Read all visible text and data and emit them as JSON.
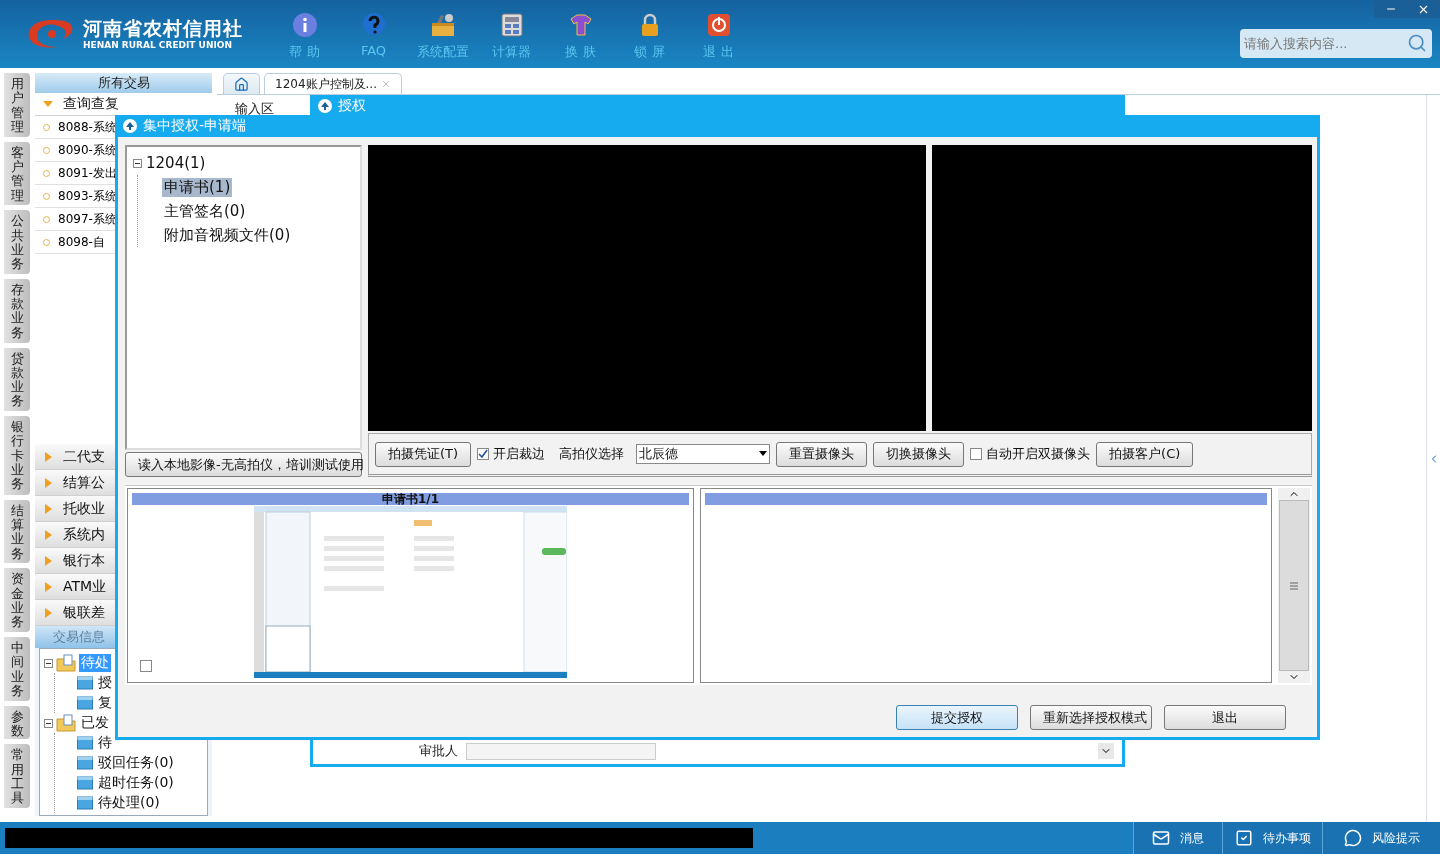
{
  "app": {
    "logo_cn": "河南省农村信用社",
    "logo_en": "HENAN RURAL CREDIT UNION"
  },
  "toolbar": [
    {
      "kind": "help",
      "label": "帮 助"
    },
    {
      "kind": "faq",
      "label": "FAQ"
    },
    {
      "kind": "config",
      "label": "系统配置"
    },
    {
      "kind": "calculator",
      "label": "计算器"
    },
    {
      "kind": "skin",
      "label": "换 肤"
    },
    {
      "kind": "lock",
      "label": "锁 屏"
    },
    {
      "kind": "exit",
      "label": "退 出"
    }
  ],
  "search": {
    "placeholder": "请输入搜索内容..."
  },
  "side_tabs": [
    "用户管理",
    "客户管理",
    "公共业务",
    "存款业务",
    "贷款业务",
    "银行卡业务",
    "结算业务",
    "资金业务",
    "中间业务",
    "参数",
    "常用工具"
  ],
  "nav": {
    "title": "所有交易",
    "open_group": {
      "label": "查询查复",
      "expanded": true,
      "items": [
        "8088-系统",
        "8090-系统",
        "8091-发出",
        "8093-系统",
        "8097-系统",
        "8098-自"
      ]
    },
    "groups": [
      {
        "label": "二代支",
        "expanded": false
      },
      {
        "label": "结算公",
        "expanded": false
      },
      {
        "label": "托收业",
        "expanded": false
      },
      {
        "label": "系统内",
        "expanded": false
      },
      {
        "label": "银行本",
        "expanded": false
      },
      {
        "label": "ATM业",
        "expanded": false
      },
      {
        "label": "银联差",
        "expanded": false
      }
    ]
  },
  "trade_info": {
    "title": "交易信息",
    "tree": [
      {
        "label": "待处",
        "selected": true,
        "expanded": true,
        "children": [
          {
            "label": "授",
            "selected": false
          },
          {
            "label": "复",
            "selected": false
          }
        ]
      },
      {
        "label": "已发",
        "selected": false,
        "expanded": true,
        "children": [
          {
            "label": "待",
            "selected": false
          },
          {
            "label": "驳回任务(0)",
            "selected": false
          },
          {
            "label": "超时任务(0)",
            "selected": false
          },
          {
            "label": "待处理(0)",
            "selected": false
          }
        ]
      }
    ]
  },
  "tabs": [
    {
      "kind": "home",
      "selected": false
    },
    {
      "kind": "text",
      "label": "1204账户控制及...",
      "selected": true
    }
  ],
  "content": {
    "section_label": "输入区"
  },
  "auth_window": {
    "title": "授权",
    "approver_label": "审批人"
  },
  "dialog": {
    "title": "集中授权-申请端",
    "tree": [
      {
        "label": "1204(1)",
        "expanded": true,
        "selected": false,
        "children": [
          {
            "label": "申请书(1)",
            "selected": true
          },
          {
            "label": "主管签名(0)",
            "selected": false
          },
          {
            "label": "附加音视频文件(0)",
            "selected": false
          }
        ]
      }
    ],
    "local_button": "读入本地影像-无高拍仪，培训测试使用",
    "controls": [
      {
        "kind": "button",
        "label": "拍摄凭证(T)"
      },
      {
        "kind": "checkbox",
        "label": "开启裁边",
        "checked": true
      },
      {
        "kind": "label",
        "label": "高拍仪选择"
      },
      {
        "kind": "select",
        "value": "北辰德"
      },
      {
        "kind": "button",
        "label": "重置摄像头"
      },
      {
        "kind": "button",
        "label": "切换摄像头"
      },
      {
        "kind": "checkbox",
        "label": "自动开启双摄像头",
        "checked": false
      },
      {
        "kind": "button",
        "label": "拍摄客户(C)"
      }
    ],
    "previews": [
      {
        "kind": "document",
        "title": "申请书1/1",
        "checked": false
      },
      {
        "kind": "empty"
      }
    ],
    "buttons": [
      {
        "label": "提交授权",
        "focused": true
      },
      {
        "label": "重新选择授权模式",
        "focused": false
      },
      {
        "label": "退出",
        "focused": false
      }
    ]
  },
  "status_bar": [
    {
      "kind": "message",
      "label": "消息"
    },
    {
      "kind": "todo",
      "label": "待办事项"
    },
    {
      "kind": "risk",
      "label": "风险提示"
    }
  ]
}
